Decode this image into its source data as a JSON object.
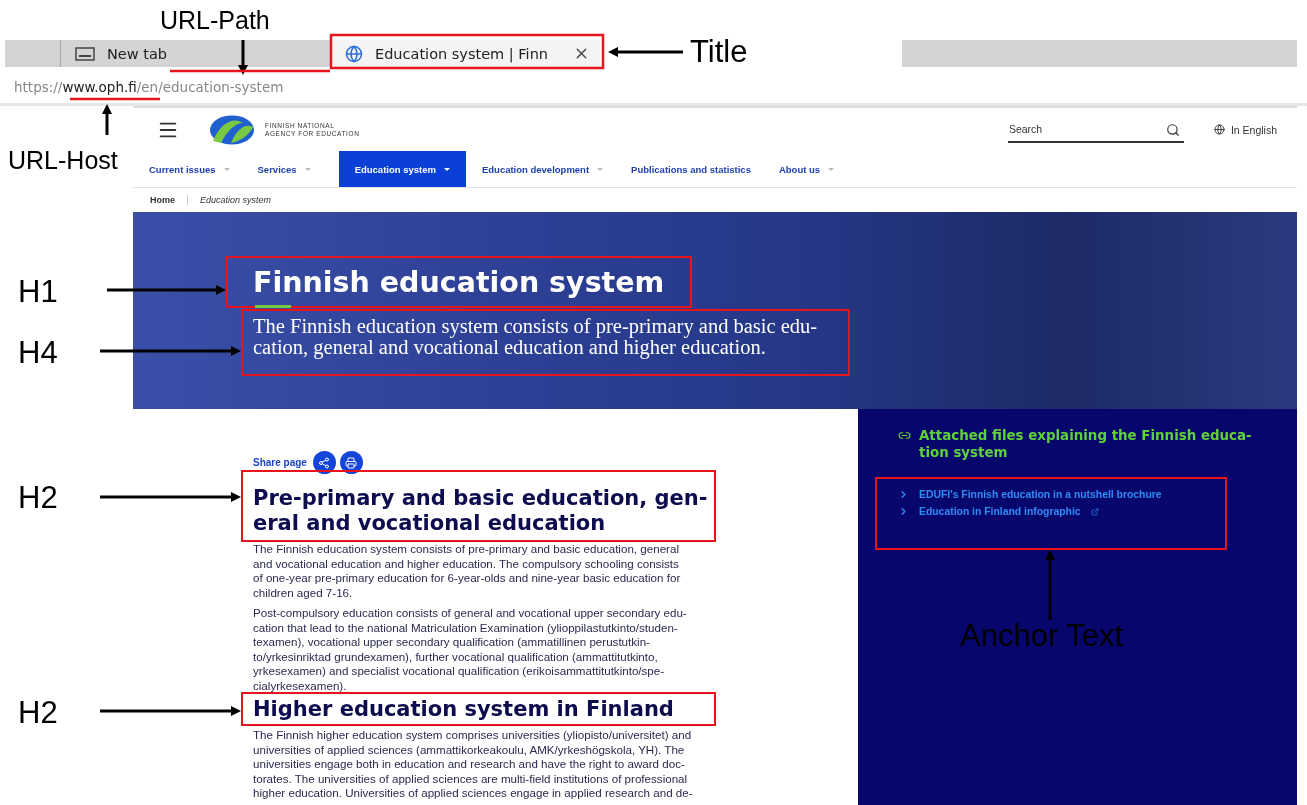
{
  "annotations": [
    {
      "label": "URL-Path"
    },
    {
      "label": "URL-Host"
    },
    {
      "label": "Title"
    },
    {
      "label": "H1"
    },
    {
      "label": "H4"
    },
    {
      "label": "H2"
    },
    {
      "label": "H2"
    },
    {
      "label": "Anchor Text"
    }
  ],
  "browser": {
    "tabs": [
      {
        "title": "New tab",
        "selected": false
      },
      {
        "title": "Education system | Finn",
        "selected": true
      }
    ],
    "url": {
      "scheme": "https://",
      "host": "www.oph.fi",
      "path": "/en/education-system"
    }
  },
  "site": {
    "logo_lines": [
      "FINNISH NATIONAL",
      "AGENCY FOR EDUCATION"
    ],
    "search": {
      "placeholder": "Search"
    },
    "language": "In English",
    "nav": [
      {
        "label": "Current issues",
        "dropdown": true,
        "selected": false
      },
      {
        "label": "Services",
        "dropdown": true,
        "selected": false
      },
      {
        "label": "Education system",
        "dropdown": true,
        "selected": true
      },
      {
        "label": "Education development",
        "dropdown": true,
        "selected": false
      },
      {
        "label": "Publications and statistics",
        "dropdown": false,
        "selected": false
      },
      {
        "label": "About us",
        "dropdown": true,
        "selected": false
      }
    ],
    "breadcrumb": [
      "Home",
      "Education system"
    ],
    "hero": {
      "title": "Finnish education system",
      "lines": [
        "The Finnish education system consists of pre-primary and basic edu-",
        "cation, general and vocational education and higher education."
      ]
    },
    "share_label": "Share page",
    "sections": [
      {
        "heading_lines": [
          "Pre-primary and basic education, gen-",
          "eral and vocational education"
        ],
        "paragraphs": [
          [
            "The Finnish education system consists of pre-primary and basic education, general",
            "and vocational education and higher education.  The compulsory schooling consists",
            "of one-year pre-primary education for 6-year-olds and nine-year basic education for",
            "children aged 7-16."
          ],
          [
            "Post-compulsory education consists of general and vocational upper secondary edu-",
            "cation that lead to the national Matriculation Examination (ylioppilastutkinto/studen-",
            "texamen), vocational upper secondary qualification (ammatillinen perustutkin-",
            "to/yrkesinriktad grundexamen), further vocational qualification (ammattitutkinto,",
            "yrkesexamen) and specialist vocational qualification (erikoisammattitutkinto/spe-",
            "cialyrkesexamen)."
          ]
        ]
      },
      {
        "heading_lines": [
          "Higher education system in Finland"
        ],
        "paragraphs": [
          [
            "The Finnish higher education system comprises universities (yliopisto/universitet) and",
            "universities of applied sciences (ammattikorkeakoulu, AMK/yrkeshögskola, YH). The",
            "universities engage both in education and research and have the right to award doc-",
            "torates. The universities of applied sciences are multi-field institutions of professional",
            "higher education. Universities of applied sciences engage in applied research and de-"
          ]
        ]
      }
    ],
    "sidebar": {
      "heading_lines": [
        "Attached files explaining the Finnish educa-",
        "tion system"
      ],
      "links": [
        {
          "label": "EDUFI's Finnish education in a nutshell brochure",
          "external": false
        },
        {
          "label": "Education in Finland infographic",
          "external": true
        }
      ]
    }
  }
}
